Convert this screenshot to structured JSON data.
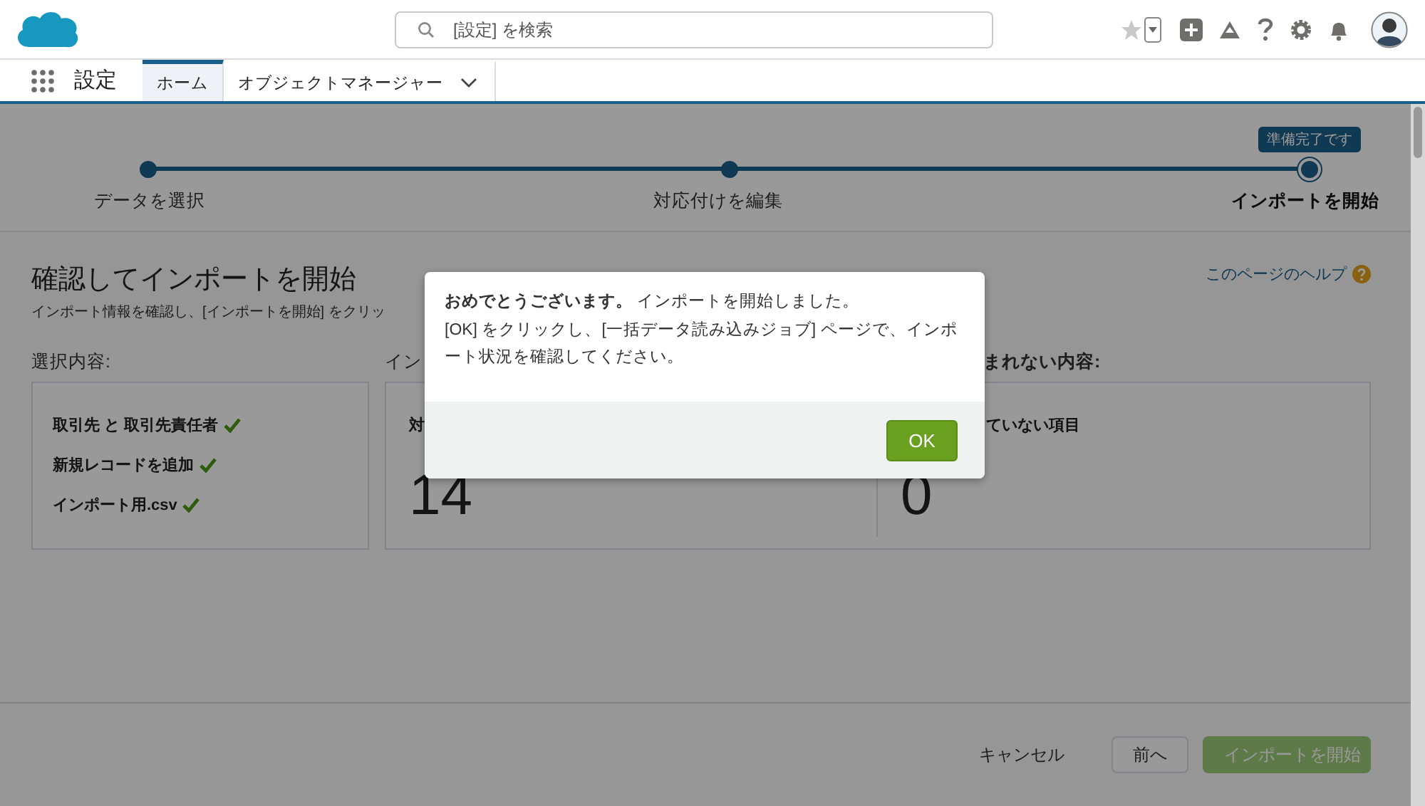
{
  "header": {
    "search": {
      "placeholder": "[設定] を検索"
    }
  },
  "app_nav": {
    "app_name": "設定",
    "tabs": [
      {
        "label": "ホーム",
        "selected": true,
        "has_menu": false
      },
      {
        "label": "オブジェクトマネージャー",
        "selected": false,
        "has_menu": true
      }
    ]
  },
  "path": {
    "tooltip": "準備完了です",
    "steps": [
      {
        "label": "データを選択",
        "selected": false
      },
      {
        "label": "対応付けを編集",
        "selected": false
      },
      {
        "label": "インポートを開始",
        "selected": true
      }
    ]
  },
  "page": {
    "title": "確認してインポートを開始",
    "subtitle": "インポート情報を確認し、[インポートを開始] をクリッ",
    "help_link": "このページのヘルプ",
    "selection": {
      "heading": "選択内容:",
      "items": [
        {
          "label": "取引先 と 取引先責任者",
          "checked": true
        },
        {
          "label": "新規レコードを追加",
          "checked": true
        },
        {
          "label": "インポート用.csv",
          "checked": true
        }
      ]
    },
    "summary": {
      "columns": [
        {
          "heading": "イン",
          "label": "対",
          "count": "14"
        },
        {
          "heading": "まれない内容:",
          "label": "ていない項目",
          "count": "0"
        }
      ]
    }
  },
  "footer": {
    "buttons": [
      {
        "label": "キャンセル",
        "kind": "link",
        "disabled": false
      },
      {
        "label": "前へ",
        "kind": "neutral",
        "disabled": false
      },
      {
        "label": "インポートを開始",
        "kind": "brand",
        "disabled": true
      }
    ]
  },
  "modal": {
    "lines": [
      "**おめでとうございます。** インポートを開始しました。",
      "[OK] をクリックし、[一括データ読み込みジョブ] ページで、インポート状況を確認してください。"
    ],
    "ok_button": "OK"
  }
}
